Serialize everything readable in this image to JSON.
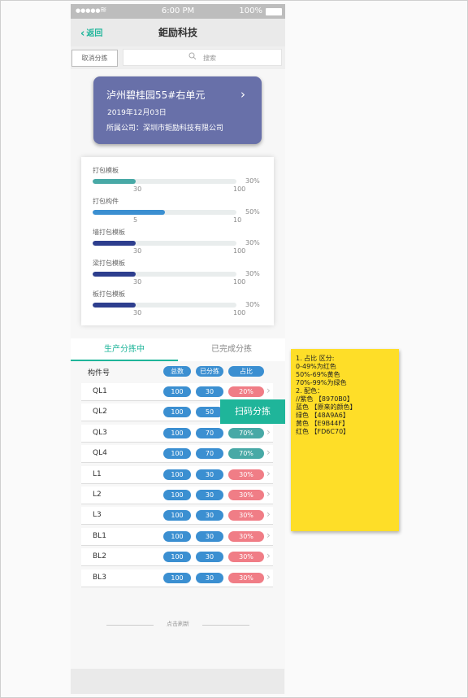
{
  "status_bar": {
    "signal": "●●●●●",
    "time": "6:00 PM",
    "battery": "100%"
  },
  "nav": {
    "back_label": "返回",
    "title": "鉅励科技"
  },
  "search": {
    "cancel_label": "取消分拣",
    "placeholder": "搜索"
  },
  "project_card": {
    "title": "泸州碧桂园55#右单元",
    "date": "2019年12月03日",
    "company": "所属公司：深圳市鉅励科技有限公司"
  },
  "progress": [
    {
      "label": "打包模板",
      "done": "30",
      "total": "100",
      "percent_text": "30%",
      "fraction": 0.3,
      "color": "#48a9a6"
    },
    {
      "label": "打包构件",
      "done": "5",
      "total": "10",
      "percent_text": "50%",
      "fraction": 0.5,
      "color": "#3b8fd1"
    },
    {
      "label": "墙打包模板",
      "done": "30",
      "total": "100",
      "percent_text": "30%",
      "fraction": 0.3,
      "color": "#2d3e8e"
    },
    {
      "label": "梁打包模板",
      "done": "30",
      "total": "100",
      "percent_text": "30%",
      "fraction": 0.3,
      "color": "#2d3e8e"
    },
    {
      "label": "板打包模板",
      "done": "30",
      "total": "100",
      "percent_text": "30%",
      "fraction": 0.3,
      "color": "#2d3e8e"
    }
  ],
  "tabs": [
    {
      "label": "生产分拣中",
      "active": true
    },
    {
      "label": "已完成分拣",
      "active": false
    }
  ],
  "table": {
    "header": {
      "name": "构件号",
      "total": "总数",
      "sorted": "已分拣",
      "ratio": "占比"
    },
    "rows": [
      {
        "name": "QL1",
        "total": "100",
        "sorted": "30",
        "ratio": "20%",
        "status": "red"
      },
      {
        "name": "QL2",
        "total": "100",
        "sorted": "50",
        "ratio": "",
        "status": "none"
      },
      {
        "name": "QL3",
        "total": "100",
        "sorted": "70",
        "ratio": "70%",
        "status": "green"
      },
      {
        "name": "QL4",
        "total": "100",
        "sorted": "70",
        "ratio": "70%",
        "status": "green"
      },
      {
        "name": "L1",
        "total": "100",
        "sorted": "30",
        "ratio": "30%",
        "status": "red"
      },
      {
        "name": "L2",
        "total": "100",
        "sorted": "30",
        "ratio": "30%",
        "status": "red"
      },
      {
        "name": "L3",
        "total": "100",
        "sorted": "30",
        "ratio": "30%",
        "status": "red"
      },
      {
        "name": "BL1",
        "total": "100",
        "sorted": "30",
        "ratio": "30%",
        "status": "red"
      },
      {
        "name": "BL2",
        "total": "100",
        "sorted": "30",
        "ratio": "30%",
        "status": "red"
      },
      {
        "name": "BL3",
        "total": "100",
        "sorted": "30",
        "ratio": "30%",
        "status": "red"
      }
    ]
  },
  "scan_button": {
    "label": "扫码分拣"
  },
  "refresh": {
    "label": "点击刷新"
  },
  "note": {
    "lines": [
      "1. 占比 区分:",
      "0-49%为红色",
      "50%-69%黄色",
      "70%-99%为绿色",
      "",
      "2. 配色：",
      "//紫色 【8970B0】",
      "蓝色 【原来的颜色】",
      "绿色 【48A9A6】",
      "黄色 【E9B44F】",
      "红色 【FD6C70】"
    ]
  },
  "colors": {
    "accent": "#1fb59a",
    "card": "#6870a9",
    "blue": "#3b8fd1",
    "green": "#48a9a6",
    "red": "#f07d86",
    "note": "#fede28"
  }
}
